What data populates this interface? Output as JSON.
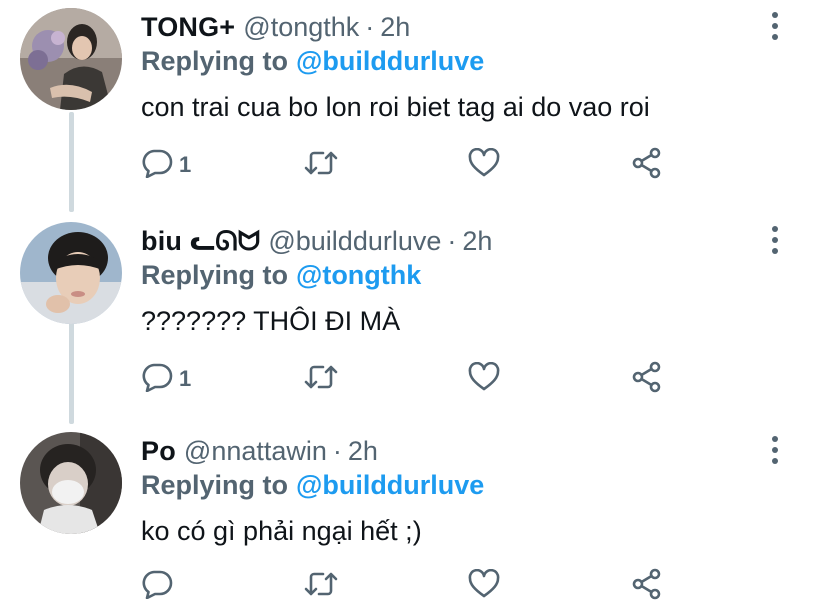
{
  "tweets": [
    {
      "name": "TONG+",
      "handle": "@tongthk",
      "separator": "·",
      "time": "2h",
      "replying_label": "Replying to",
      "replying_to": "@builddurluve",
      "text": "con trai cua bo lon roi biet tag ai do vao roi",
      "reply_count": "1"
    },
    {
      "name": "biu ᓚᘏᗢ",
      "handle": "@builddurluve",
      "separator": "·",
      "time": "2h",
      "replying_label": "Replying to",
      "replying_to": "@tongthk",
      "text": "??????? THÔI ĐI MÀ",
      "reply_count": "1"
    },
    {
      "name": "Po",
      "handle": "@nnattawin",
      "separator": "·",
      "time": "2h",
      "replying_label": "Replying to",
      "replying_to": "@builddurluve",
      "text": "ko có gì phải ngại hết ;)",
      "reply_count": ""
    }
  ],
  "colors": {
    "accent": "#1d9bf0",
    "secondary_text": "#536471",
    "primary_text": "#0f1419",
    "thread_line": "#cfd9de"
  },
  "icons": [
    "reply-icon",
    "retweet-icon",
    "like-icon",
    "share-icon",
    "more-options-icon"
  ]
}
